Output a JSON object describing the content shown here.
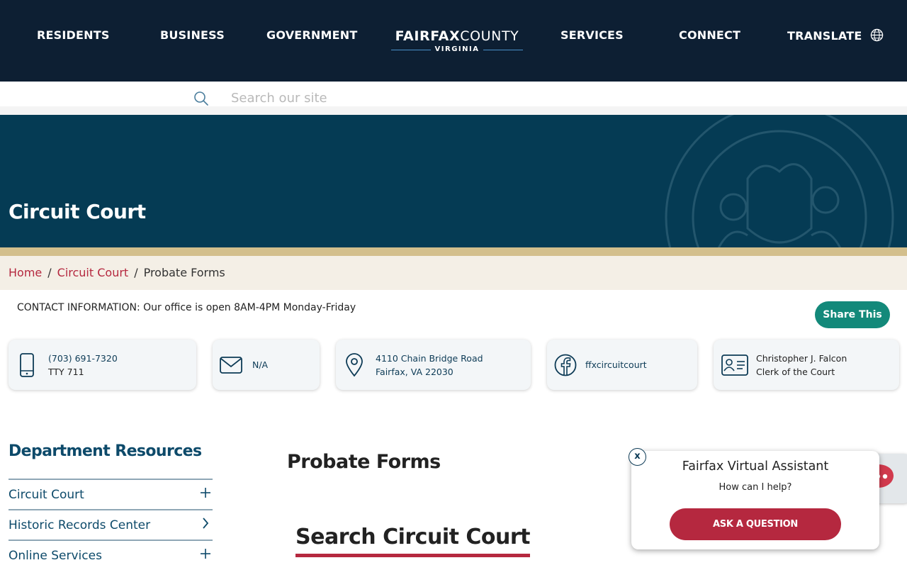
{
  "nav": {
    "items": [
      "RESIDENTS",
      "BUSINESS",
      "GOVERNMENT",
      "SERVICES",
      "CONNECT"
    ],
    "translate": "TRANSLATE",
    "logo_bold": "FAIRFAX",
    "logo_light": "COUNTY",
    "logo_sub": "VIRGINIA"
  },
  "search": {
    "placeholder": "Search our site",
    "value": ""
  },
  "hero": {
    "title": "Circuit Court"
  },
  "breadcrumb": {
    "items": [
      "Home",
      "Circuit Court",
      "Probate Forms"
    ]
  },
  "contact": {
    "info": "CONTACT INFORMATION: Our office is open 8AM-4PM Monday-Friday",
    "share_label": "Share This",
    "phone": "(703) 691-7320",
    "tty": "TTY 711",
    "email": "N/A",
    "address_line1": "4110 Chain Bridge Road",
    "address_line2": "Fairfax, VA 22030",
    "facebook": "ffxcircuitcourt",
    "person_name": "Christopher J. Falcon",
    "person_title": "Clerk of the Court"
  },
  "sidebar": {
    "title": "Department Resources",
    "items": [
      {
        "label": "Circuit Court",
        "icon": "plus-icon"
      },
      {
        "label": "Historic Records Center",
        "icon": "chevron-right-icon"
      },
      {
        "label": "Online Services",
        "icon": "plus-icon"
      }
    ]
  },
  "main": {
    "title": "Probate Forms",
    "section_heading": "Search Circuit Court"
  },
  "chat": {
    "close_label": "x",
    "title": "Fairfax Virtual Assistant",
    "subtitle": "How can I help?",
    "ask_label": "ASK A QUESTION"
  },
  "colors": {
    "nav_bg": "#0d1f33",
    "hero_bg": "#053b54",
    "gold": "#d3bf8c",
    "accent_red": "#b5283f",
    "teal": "#13897a",
    "breadcrumb_bg": "#f4efe6"
  }
}
